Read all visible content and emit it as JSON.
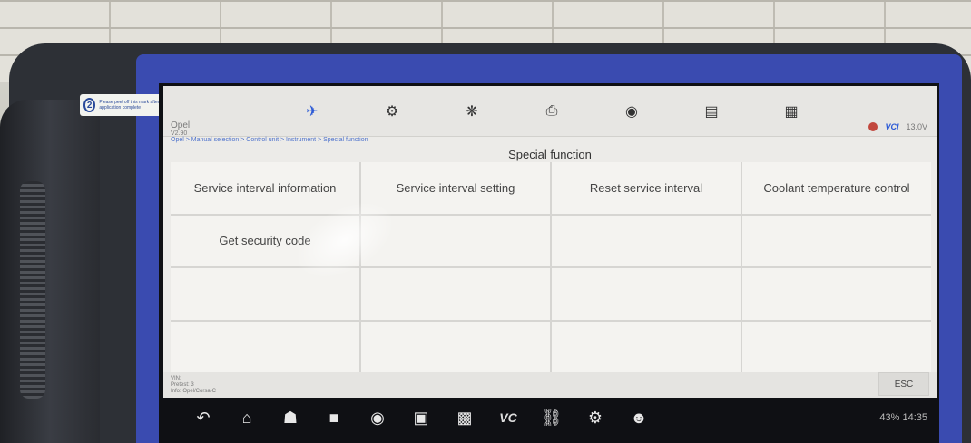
{
  "sticker": {
    "num": "2",
    "text": "Please peel off this mark after application complete"
  },
  "header": {
    "brand": "Opel",
    "brand_version": "V2.90",
    "voltage": "13.0V",
    "vci": "VCI"
  },
  "toolbar": {
    "icons": [
      "home-car-icon",
      "diagnostics-icon",
      "settings-icon",
      "print-icon",
      "help-icon",
      "save-icon",
      "data-icon"
    ]
  },
  "breadcrumb": "Opel > Manual selection > Control unit > Instrument > Special function",
  "panel": {
    "title": "Special function",
    "cells": [
      "Service interval information",
      "Service interval setting",
      "Reset service interval",
      "Coolant temperature control",
      "Get security code",
      "",
      "",
      "",
      "",
      "",
      "",
      "",
      "",
      "",
      "",
      ""
    ]
  },
  "footer": {
    "vin": "VIN:",
    "pretest": "Pretest: 3",
    "info": "Info: Opel/Corsa-C",
    "esc": "ESC"
  },
  "navbar": {
    "vci": "VC",
    "status": "43% 14:35"
  }
}
